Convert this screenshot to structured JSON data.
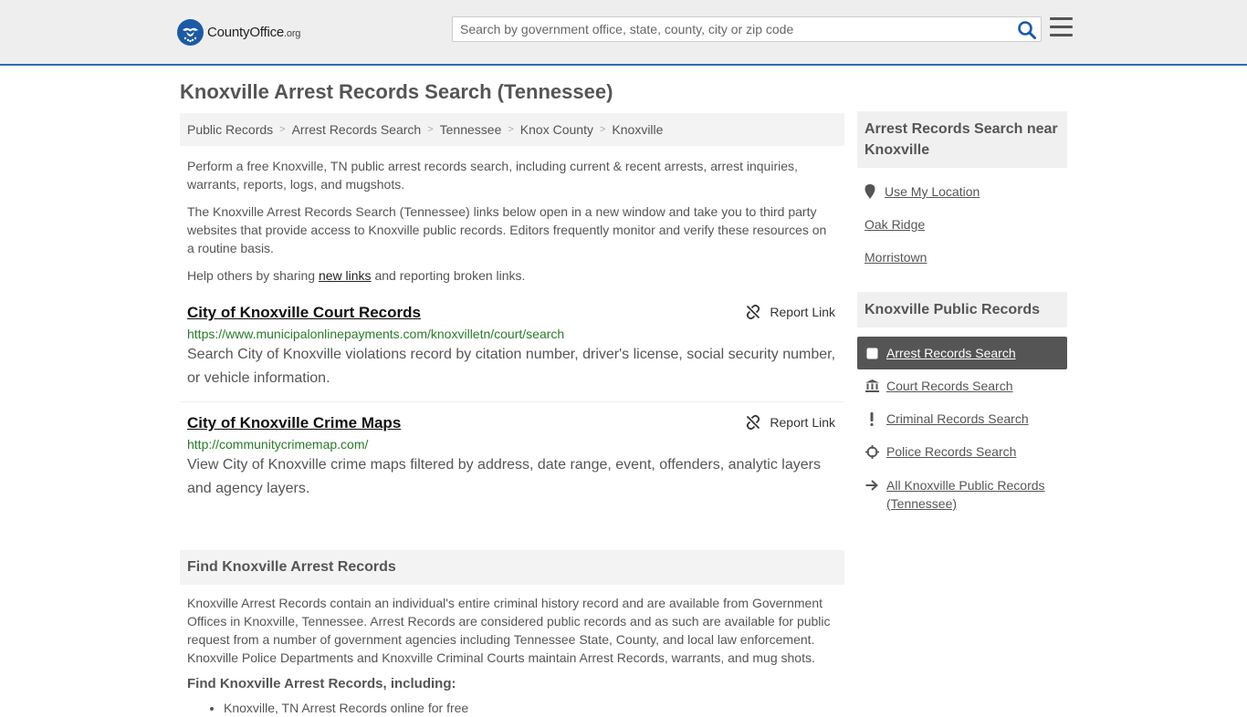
{
  "header": {
    "logo_main": "CountyOffice",
    "logo_tld": ".org",
    "search_placeholder": "Search by government office, state, county, city or zip code"
  },
  "page": {
    "title": "Knoxville Arrest Records Search (Tennessee)"
  },
  "breadcrumb": [
    "Public Records",
    "Arrest Records Search",
    "Tennessee",
    "Knox County",
    "Knoxville"
  ],
  "intro": {
    "p1": "Perform a free Knoxville, TN public arrest records search, including current & recent arrests, arrest inquiries, warrants, reports, logs, and mugshots.",
    "p2": "The Knoxville Arrest Records Search (Tennessee) links below open in a new window and take you to third party websites that provide access to Knoxville public records. Editors frequently monitor and verify these resources on a routine basis.",
    "p3_before": "Help others by sharing ",
    "p3_link": "new links",
    "p3_after": " and reporting broken links."
  },
  "results": [
    {
      "title": "City of Knoxville Court Records",
      "url": "https://www.municipalonlinepayments.com/knoxvilletn/court/search",
      "description": "Search City of Knoxville violations record by citation number, driver's license, social security number, or vehicle information.",
      "report_label": "Report Link"
    },
    {
      "title": "City of Knoxville Crime Maps",
      "url": "http://communitycrimemap.com/",
      "description": "View City of Knoxville crime maps filtered by address, date range, event, offenders, analytic layers and agency layers.",
      "report_label": "Report Link"
    }
  ],
  "find_section": {
    "heading": "Find Knoxville Arrest Records",
    "body": "Knoxville Arrest Records contain an individual's entire criminal history record and are available from Government Offices in Knoxville, Tennessee. Arrest Records are considered public records and as such are available for public request from a number of government agencies including Tennessee State, County, and local law enforcement. Knoxville Police Departments and Knoxville Criminal Courts maintain Arrest Records, warrants, and mug shots.",
    "sub_heading": "Find Knoxville Arrest Records, including:",
    "bullets": [
      "Knoxville, TN Arrest Records online for free"
    ]
  },
  "sidebar": {
    "near_heading": "Arrest Records Search near Knoxville",
    "near_items": [
      "Use My Location",
      "Oak Ridge",
      "Morristown"
    ],
    "pr_heading": "Knoxville Public Records",
    "pr_items": [
      {
        "label": "Arrest Records Search",
        "icon": "square-icon"
      },
      {
        "label": "Court Records Search",
        "icon": "courthouse-icon"
      },
      {
        "label": "Criminal Records Search",
        "icon": "exclamation-icon"
      },
      {
        "label": "Police Records Search",
        "icon": "crosshair-icon"
      },
      {
        "label": "All Knoxville Public Records (Tennessee)",
        "icon": "arrow-right-icon"
      }
    ]
  },
  "colors": {
    "brand_blue": "#1c5aa5",
    "header_border": "#2e6fb5",
    "url_green": "#2a7a2a",
    "active_bg": "#555555"
  }
}
